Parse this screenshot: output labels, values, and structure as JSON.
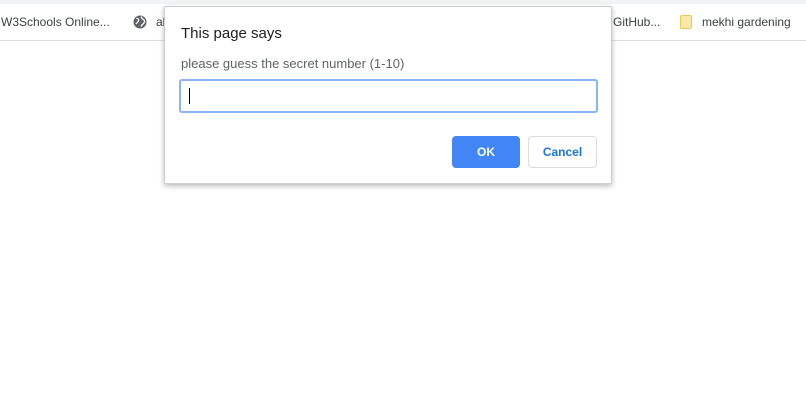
{
  "bookmarks_bar": {
    "items": [
      {
        "label": "W3Schools Online...",
        "icon": "none"
      },
      {
        "label": "ab",
        "icon": "globe-icon"
      },
      {
        "label": "GitHub...",
        "icon": "none"
      },
      {
        "label": "mekhi gardening",
        "icon": "folder-icon"
      }
    ]
  },
  "dialog": {
    "title": "This page says",
    "message": "please guess the secret number (1-10)",
    "input_value": "",
    "ok_label": "OK",
    "cancel_label": "Cancel"
  },
  "colors": {
    "ok_button": "#4285f4",
    "cancel_text": "#1a73e8",
    "focus_ring": "#8ab4f8",
    "folder": "#fce8a6"
  }
}
